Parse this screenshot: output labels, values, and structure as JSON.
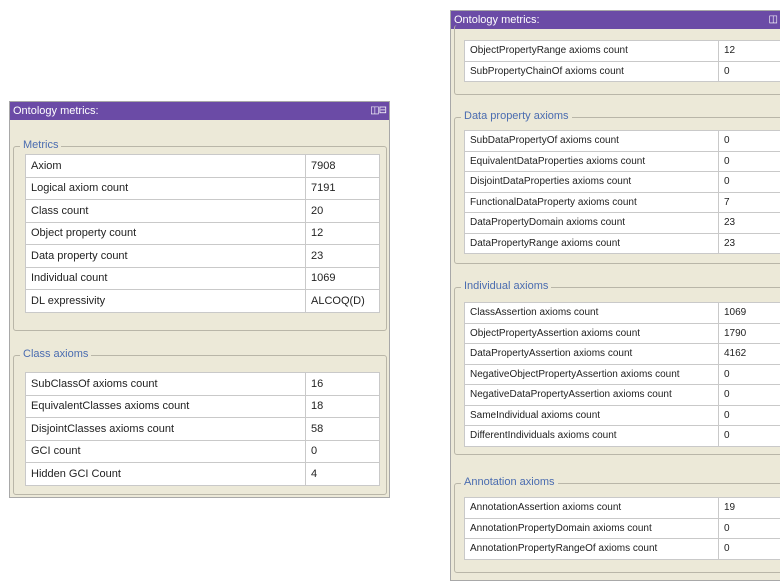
{
  "left_panel": {
    "title": "Ontology metrics:",
    "sections": [
      {
        "title": "Metrics",
        "rows": [
          {
            "label": "Axiom",
            "value": "7908"
          },
          {
            "label": "Logical axiom count",
            "value": "7191"
          },
          {
            "label": "Class count",
            "value": "20"
          },
          {
            "label": "Object property count",
            "value": "12"
          },
          {
            "label": "Data property count",
            "value": "23"
          },
          {
            "label": "Individual count",
            "value": "1069"
          },
          {
            "label": "DL expressivity",
            "value": "ALCOQ(D)"
          }
        ]
      },
      {
        "title": "Class axioms",
        "rows": [
          {
            "label": "SubClassOf axioms count",
            "value": "16"
          },
          {
            "label": "EquivalentClasses axioms count",
            "value": "18"
          },
          {
            "label": "DisjointClasses axioms count",
            "value": "58"
          },
          {
            "label": "GCI count",
            "value": "0"
          },
          {
            "label": "Hidden GCI Count",
            "value": "4"
          }
        ]
      }
    ]
  },
  "right_panel": {
    "title": "Ontology metrics:",
    "sections": [
      {
        "title": "",
        "rows": [
          {
            "label": "ObjectPropertyRange axioms count",
            "value": "12"
          },
          {
            "label": "SubPropertyChainOf axioms count",
            "value": "0"
          }
        ]
      },
      {
        "title": "Data property axioms",
        "rows": [
          {
            "label": "SubDataPropertyOf axioms count",
            "value": "0"
          },
          {
            "label": "EquivalentDataProperties axioms count",
            "value": "0"
          },
          {
            "label": "DisjointDataProperties axioms count",
            "value": "0"
          },
          {
            "label": "FunctionalDataProperty axioms count",
            "value": "7"
          },
          {
            "label": "DataPropertyDomain axioms count",
            "value": "23"
          },
          {
            "label": "DataPropertyRange axioms count",
            "value": "23"
          }
        ]
      },
      {
        "title": "Individual axioms",
        "rows": [
          {
            "label": "ClassAssertion axioms count",
            "value": "1069"
          },
          {
            "label": "ObjectPropertyAssertion axioms count",
            "value": "1790"
          },
          {
            "label": "DataPropertyAssertion axioms count",
            "value": "4162"
          },
          {
            "label": "NegativeObjectPropertyAssertion axioms count",
            "value": "0"
          },
          {
            "label": "NegativeDataPropertyAssertion axioms count",
            "value": "0"
          },
          {
            "label": "SameIndividual axioms count",
            "value": "0"
          },
          {
            "label": "DifferentIndividuals axioms count",
            "value": "0"
          }
        ]
      },
      {
        "title": "Annotation axioms",
        "rows": [
          {
            "label": "AnnotationAssertion axioms count",
            "value": "19"
          },
          {
            "label": "AnnotationPropertyDomain axioms count",
            "value": "0"
          },
          {
            "label": "AnnotationPropertyRangeOf axioms count",
            "value": "0"
          }
        ]
      }
    ]
  }
}
